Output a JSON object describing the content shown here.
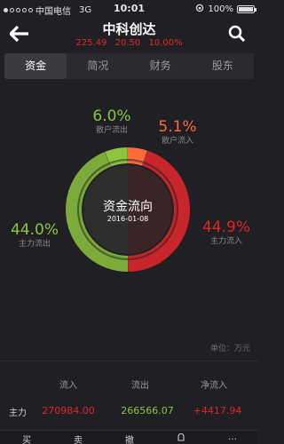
{
  "status_bar": {
    "carrier": "中国电信",
    "network": "3G",
    "time": "10:01",
    "battery": "100%"
  },
  "nav": {
    "title": "中科创达",
    "price": "225.49",
    "change": "20.50",
    "change_pct": "10.00%"
  },
  "tabs": [
    {
      "label": "资金",
      "active": true
    },
    {
      "label": "简况",
      "active": false
    },
    {
      "label": "财务",
      "active": false
    },
    {
      "label": "股东",
      "active": false
    }
  ],
  "fund_flow": {
    "center_title": "资金流向",
    "center_date": "2016-01-08",
    "retail_out": {
      "pct": "6.0%",
      "label": "散户流出",
      "value": 6.0,
      "color": "#8cc63f"
    },
    "retail_in": {
      "pct": "5.1%",
      "label": "散户流入",
      "value": 5.1,
      "color": "#ff6a3d"
    },
    "main_out": {
      "pct": "44.0%",
      "label": "主力流出",
      "value": 44.0,
      "color": "#7cab3a"
    },
    "main_in": {
      "pct": "44.9%",
      "label": "主力流入",
      "value": 44.9,
      "color": "#c8262a"
    }
  },
  "unit": "单位：万元",
  "table": {
    "headers": [
      "流入",
      "流出",
      "净流入"
    ],
    "rows": [
      {
        "label": "主力",
        "inflow": "270984.00",
        "outflow": "266566.07",
        "net": "+4417.94"
      }
    ]
  },
  "toolbar": [
    "买",
    "卖",
    "撤",
    "…"
  ]
}
